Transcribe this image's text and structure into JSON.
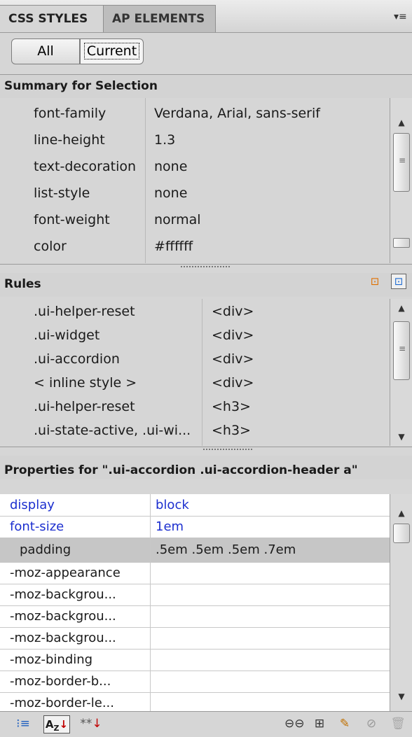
{
  "tabs": [
    {
      "label": "CSS STYLES"
    },
    {
      "label": "AP ELEMENTS"
    }
  ],
  "mode_buttons": {
    "all": "All",
    "current": "Current"
  },
  "summary": {
    "heading": "Summary for Selection",
    "rows": [
      {
        "name": "font-family",
        "value": "Verdana, Arial, sans-serif"
      },
      {
        "name": "line-height",
        "value": "1.3"
      },
      {
        "name": "text-decoration",
        "value": "none"
      },
      {
        "name": "list-style",
        "value": "none"
      },
      {
        "name": "font-weight",
        "value": "normal"
      },
      {
        "name": "color",
        "value": "#ffffff"
      }
    ]
  },
  "rules": {
    "heading": "Rules",
    "rows": [
      {
        "selector": ".ui-helper-reset",
        "tag": "<div>"
      },
      {
        "selector": ".ui-widget",
        "tag": "<div>"
      },
      {
        "selector": ".ui-accordion",
        "tag": "<div>"
      },
      {
        "selector": "< inline style >",
        "tag": "<div>"
      },
      {
        "selector": ".ui-helper-reset",
        "tag": "<h3>"
      },
      {
        "selector": ".ui-state-active, .ui-wi...",
        "tag": "<h3>"
      }
    ]
  },
  "properties": {
    "heading": "Properties for \".ui-accordion .ui-accordion-header a\"",
    "rows": [
      {
        "name": "display",
        "value": "block",
        "set": true
      },
      {
        "name": "font-size",
        "value": "1em",
        "set": true
      },
      {
        "name": "padding",
        "value": ".5em .5em .5em .7em",
        "set": false,
        "selected": true
      },
      {
        "name": "-moz-appearance",
        "value": ""
      },
      {
        "name": "-moz-backgrou...",
        "value": ""
      },
      {
        "name": "-moz-backgrou...",
        "value": ""
      },
      {
        "name": "-moz-backgrou...",
        "value": ""
      },
      {
        "name": "-moz-binding",
        "value": ""
      },
      {
        "name": "-moz-border-b...",
        "value": ""
      },
      {
        "name": "-moz-border-le...",
        "value": ""
      }
    ]
  },
  "colors": {
    "set_property": "#1c2fcf",
    "selected_row": "#c6c6c6"
  },
  "icons": [
    "panel-menu-icon",
    "category-view-icon",
    "alpha-sort-icon",
    "set-properties-icon",
    "attach-stylesheet-icon",
    "new-rule-icon",
    "edit-rule-icon",
    "disable-property-icon",
    "delete-rule-icon"
  ]
}
